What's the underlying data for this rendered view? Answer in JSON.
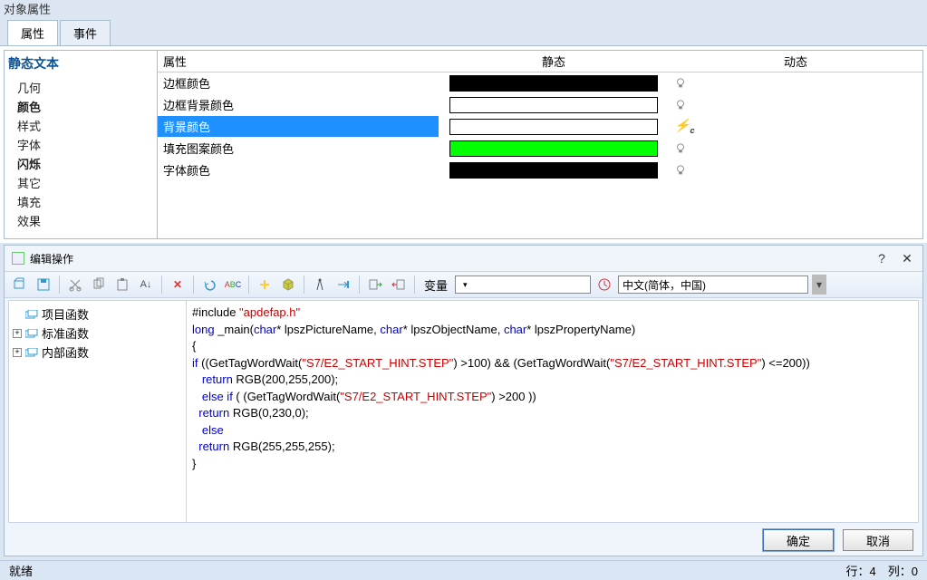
{
  "window_title": "对象属性",
  "tabs": {
    "attr": "属性",
    "event": "事件"
  },
  "tree": {
    "title": "静态文本",
    "items": [
      {
        "label": "几何",
        "bold": false
      },
      {
        "label": "颜色",
        "bold": true
      },
      {
        "label": "样式",
        "bold": false
      },
      {
        "label": "字体",
        "bold": false
      },
      {
        "label": "闪烁",
        "bold": true
      },
      {
        "label": "其它",
        "bold": false
      },
      {
        "label": "填充",
        "bold": false
      },
      {
        "label": "效果",
        "bold": false
      }
    ]
  },
  "prop_table": {
    "headers": {
      "attr": "属性",
      "stat": "静态",
      "dyn": "动态"
    },
    "rows": [
      {
        "label": "边框颜色",
        "color": "#000000",
        "dyn": "bulb"
      },
      {
        "label": "边框背景颜色",
        "color": "#ffffff",
        "dyn": "bulb"
      },
      {
        "label": "背景颜色",
        "color": "#ffffff",
        "dyn": "bolt",
        "selected": true
      },
      {
        "label": "填充图案颜色",
        "color": "#00ff00",
        "dyn": "bulb"
      },
      {
        "label": "字体颜色",
        "color": "#000000",
        "dyn": "bulb"
      }
    ]
  },
  "editor": {
    "title": "编辑操作",
    "toolbar": {
      "var_label": "变量",
      "lang_label": "中文(简体，中国)"
    },
    "func_tree": [
      {
        "label": "项目函数",
        "expandable": false
      },
      {
        "label": "标准函数",
        "expandable": true
      },
      {
        "label": "内部函数",
        "expandable": true
      }
    ],
    "code": {
      "l1a": "#include ",
      "l1b": "\"apdefap.h\"",
      "l2a": "long",
      "l2b": " _main(",
      "l2c": "char",
      "l2d": "* lpszPictureName, ",
      "l2e": "char",
      "l2f": "* lpszObjectName, ",
      "l2g": "char",
      "l2h": "* lpszPropertyName)",
      "l3": "{",
      "l4a": "if",
      "l4b": " ((GetTagWordWait(",
      "l4c": "\"S7/E2_START_HINT.STEP\"",
      "l4d": ") >100) && (GetTagWordWait(",
      "l4e": "\"S7/E2_START_HINT.STEP\"",
      "l4f": ") <=200))",
      "l5a": "   ",
      "l5b": "return",
      "l5c": " RGB(200,255,200);",
      "l6a": "   ",
      "l6b": "else if",
      "l6c": " ( (GetTagWordWait(",
      "l6d": "\"S7/E2_START_HINT.STEP\"",
      "l6e": ") >200 ))",
      "l7a": "  ",
      "l7b": "return",
      "l7c": " RGB(0,230,0);",
      "l8a": "   ",
      "l8b": "else",
      "l9a": "  ",
      "l9b": "return",
      "l9c": " RGB(255,255,255);",
      "l10": "}"
    },
    "buttons": {
      "ok": "确定",
      "cancel": "取消"
    }
  },
  "status": {
    "ready": "就绪",
    "pos": "行：4　列：0"
  }
}
